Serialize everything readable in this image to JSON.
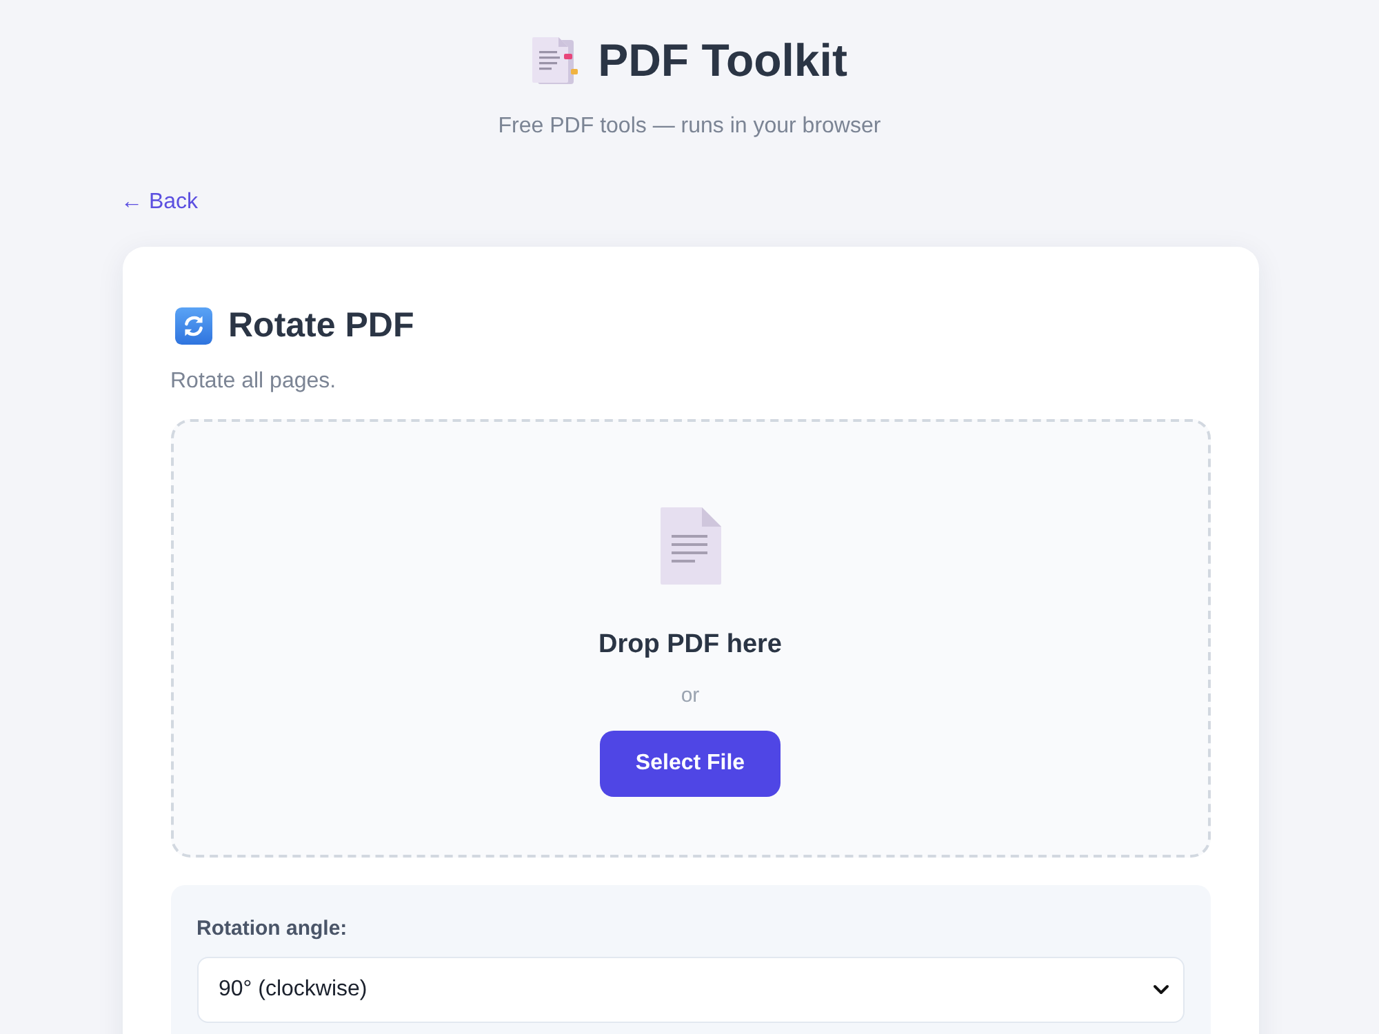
{
  "header": {
    "title": "PDF Toolkit",
    "subtitle": "Free PDF tools — runs in your browser"
  },
  "back_link": {
    "label": "← Back"
  },
  "tool": {
    "title": "Rotate PDF",
    "description": "Rotate all pages.",
    "dropzone": {
      "heading": "Drop PDF here",
      "separator": "or",
      "button": "Select File"
    },
    "options": {
      "label": "Rotation angle:",
      "value": "90° (clockwise)"
    }
  }
}
